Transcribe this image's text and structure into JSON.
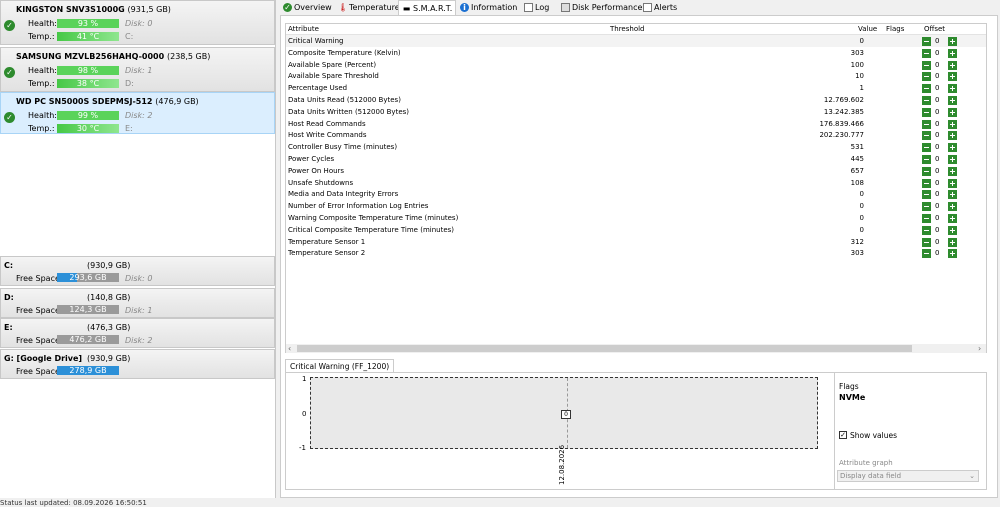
{
  "disks": [
    {
      "model": "KINGSTON SNV3S1000G",
      "size": "(931,5 GB)",
      "health_label": "Health:",
      "health": "93 %",
      "health_pct": 93,
      "disk": "Disk: 0",
      "temp_label": "Temp.:",
      "temp": "41 °C",
      "drive": "C:"
    },
    {
      "model": "SAMSUNG MZVLB256HAHQ-0000",
      "size": "(238,5 GB)",
      "health_label": "Health:",
      "health": "98 %",
      "health_pct": 98,
      "disk": "Disk: 1",
      "temp_label": "Temp.:",
      "temp": "38 °C",
      "drive": "D:"
    },
    {
      "model": "WD PC SN5000S SDEPMSJ-512",
      "size": "(476,9 GB)",
      "health_label": "Health:",
      "health": "99 %",
      "health_pct": 99,
      "disk": "Disk: 2",
      "temp_label": "Temp.:",
      "temp": "30 °C",
      "drive": "E:"
    }
  ],
  "volumes": [
    {
      "name": "C:",
      "size": "(930,9 GB)",
      "free_label": "Free Space",
      "free": "293,6 GB",
      "free_frac": 0.315,
      "disk": "Disk: 0"
    },
    {
      "name": "D:",
      "size": "(140,8 GB)",
      "free_label": "Free Space",
      "free": "124,3 GB",
      "free_frac": 0.0,
      "disk": "Disk: 1"
    },
    {
      "name": "E:",
      "size": "(476,3 GB)",
      "free_label": "Free Space",
      "free": "476,2 GB",
      "free_frac": 0.0,
      "disk": "Disk: 2"
    },
    {
      "name": "G: [Google Drive]",
      "size": "(930,9 GB)",
      "free_label": "Free Space",
      "free": "278,9 GB",
      "free_frac": 1.0,
      "disk": ""
    }
  ],
  "status": "Status last updated: 08.09.2026 16:50:51",
  "tabs": [
    {
      "label": "Overview",
      "icon": "check-circle-icon"
    },
    {
      "label": "Temperature",
      "icon": "thermometer-icon"
    },
    {
      "label": "S.M.A.R.T.",
      "icon": "minus-icon"
    },
    {
      "label": "Information",
      "icon": "info-icon"
    },
    {
      "label": "Log",
      "icon": "log-icon"
    },
    {
      "label": "Disk Performance",
      "icon": "disk-icon"
    },
    {
      "label": "Alerts",
      "icon": "alerts-icon"
    }
  ],
  "table": {
    "headers": {
      "attribute": "Attribute",
      "threshold": "Threshold",
      "value": "Value",
      "flags": "Flags",
      "offset": "Offset"
    },
    "rows": [
      {
        "name": "Critical Warning",
        "value": "0",
        "offset": "0"
      },
      {
        "name": "Composite Temperature (Kelvin)",
        "value": "303",
        "offset": "0"
      },
      {
        "name": "Available Spare (Percent)",
        "value": "100",
        "offset": "0"
      },
      {
        "name": "Available Spare Threshold",
        "value": "10",
        "offset": "0"
      },
      {
        "name": "Percentage Used",
        "value": "1",
        "offset": "0"
      },
      {
        "name": "Data Units Read (512000 Bytes)",
        "value": "12.769.602",
        "offset": "0"
      },
      {
        "name": "Data Units Written (512000 Bytes)",
        "value": "13.242.385",
        "offset": "0"
      },
      {
        "name": "Host Read Commands",
        "value": "176.839.466",
        "offset": "0"
      },
      {
        "name": "Host Write Commands",
        "value": "202.230.777",
        "offset": "0"
      },
      {
        "name": "Controller Busy Time (minutes)",
        "value": "531",
        "offset": "0"
      },
      {
        "name": "Power Cycles",
        "value": "445",
        "offset": "0"
      },
      {
        "name": "Power On Hours",
        "value": "657",
        "offset": "0"
      },
      {
        "name": "Unsafe Shutdowns",
        "value": "108",
        "offset": "0"
      },
      {
        "name": "Media and Data Integrity Errors",
        "value": "0",
        "offset": "0"
      },
      {
        "name": "Number of Error Information Log Entries",
        "value": "0",
        "offset": "0"
      },
      {
        "name": "Warning Composite Temperature Time (minutes)",
        "value": "0",
        "offset": "0"
      },
      {
        "name": "Critical Composite Temperature Time (minutes)",
        "value": "0",
        "offset": "0"
      },
      {
        "name": "Temperature Sensor 1",
        "value": "312",
        "offset": "0"
      },
      {
        "name": "Temperature Sensor 2",
        "value": "303",
        "offset": "0"
      }
    ]
  },
  "graph": {
    "tab": "Critical Warning (FF_1200)",
    "y_ticks": [
      "1",
      "0",
      "-1"
    ],
    "point_label": "0",
    "date": "12.08.2026",
    "flags_label": "Flags",
    "flags_value": "NVMe",
    "show_values": "Show values",
    "attr_graph_label": "Attribute graph",
    "attr_graph_value": "Display data field"
  }
}
